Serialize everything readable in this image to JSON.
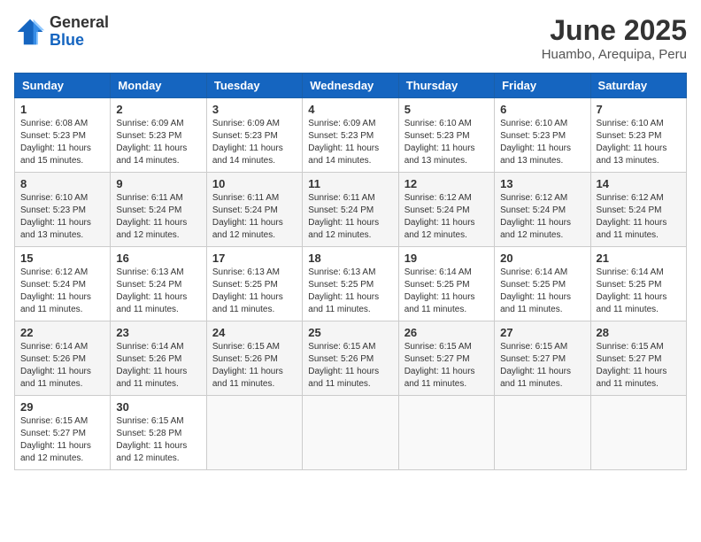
{
  "header": {
    "logo_general": "General",
    "logo_blue": "Blue",
    "month_title": "June 2025",
    "location": "Huambo, Arequipa, Peru"
  },
  "weekdays": [
    "Sunday",
    "Monday",
    "Tuesday",
    "Wednesday",
    "Thursday",
    "Friday",
    "Saturday"
  ],
  "weeks": [
    [
      {
        "day": 1,
        "sunrise": "6:08 AM",
        "sunset": "5:23 PM",
        "daylight": "11 hours and 15 minutes."
      },
      {
        "day": 2,
        "sunrise": "6:09 AM",
        "sunset": "5:23 PM",
        "daylight": "11 hours and 14 minutes."
      },
      {
        "day": 3,
        "sunrise": "6:09 AM",
        "sunset": "5:23 PM",
        "daylight": "11 hours and 14 minutes."
      },
      {
        "day": 4,
        "sunrise": "6:09 AM",
        "sunset": "5:23 PM",
        "daylight": "11 hours and 14 minutes."
      },
      {
        "day": 5,
        "sunrise": "6:10 AM",
        "sunset": "5:23 PM",
        "daylight": "11 hours and 13 minutes."
      },
      {
        "day": 6,
        "sunrise": "6:10 AM",
        "sunset": "5:23 PM",
        "daylight": "11 hours and 13 minutes."
      },
      {
        "day": 7,
        "sunrise": "6:10 AM",
        "sunset": "5:23 PM",
        "daylight": "11 hours and 13 minutes."
      }
    ],
    [
      {
        "day": 8,
        "sunrise": "6:10 AM",
        "sunset": "5:23 PM",
        "daylight": "11 hours and 13 minutes."
      },
      {
        "day": 9,
        "sunrise": "6:11 AM",
        "sunset": "5:24 PM",
        "daylight": "11 hours and 12 minutes."
      },
      {
        "day": 10,
        "sunrise": "6:11 AM",
        "sunset": "5:24 PM",
        "daylight": "11 hours and 12 minutes."
      },
      {
        "day": 11,
        "sunrise": "6:11 AM",
        "sunset": "5:24 PM",
        "daylight": "11 hours and 12 minutes."
      },
      {
        "day": 12,
        "sunrise": "6:12 AM",
        "sunset": "5:24 PM",
        "daylight": "11 hours and 12 minutes."
      },
      {
        "day": 13,
        "sunrise": "6:12 AM",
        "sunset": "5:24 PM",
        "daylight": "11 hours and 12 minutes."
      },
      {
        "day": 14,
        "sunrise": "6:12 AM",
        "sunset": "5:24 PM",
        "daylight": "11 hours and 11 minutes."
      }
    ],
    [
      {
        "day": 15,
        "sunrise": "6:12 AM",
        "sunset": "5:24 PM",
        "daylight": "11 hours and 11 minutes."
      },
      {
        "day": 16,
        "sunrise": "6:13 AM",
        "sunset": "5:24 PM",
        "daylight": "11 hours and 11 minutes."
      },
      {
        "day": 17,
        "sunrise": "6:13 AM",
        "sunset": "5:25 PM",
        "daylight": "11 hours and 11 minutes."
      },
      {
        "day": 18,
        "sunrise": "6:13 AM",
        "sunset": "5:25 PM",
        "daylight": "11 hours and 11 minutes."
      },
      {
        "day": 19,
        "sunrise": "6:14 AM",
        "sunset": "5:25 PM",
        "daylight": "11 hours and 11 minutes."
      },
      {
        "day": 20,
        "sunrise": "6:14 AM",
        "sunset": "5:25 PM",
        "daylight": "11 hours and 11 minutes."
      },
      {
        "day": 21,
        "sunrise": "6:14 AM",
        "sunset": "5:25 PM",
        "daylight": "11 hours and 11 minutes."
      }
    ],
    [
      {
        "day": 22,
        "sunrise": "6:14 AM",
        "sunset": "5:26 PM",
        "daylight": "11 hours and 11 minutes."
      },
      {
        "day": 23,
        "sunrise": "6:14 AM",
        "sunset": "5:26 PM",
        "daylight": "11 hours and 11 minutes."
      },
      {
        "day": 24,
        "sunrise": "6:15 AM",
        "sunset": "5:26 PM",
        "daylight": "11 hours and 11 minutes."
      },
      {
        "day": 25,
        "sunrise": "6:15 AM",
        "sunset": "5:26 PM",
        "daylight": "11 hours and 11 minutes."
      },
      {
        "day": 26,
        "sunrise": "6:15 AM",
        "sunset": "5:27 PM",
        "daylight": "11 hours and 11 minutes."
      },
      {
        "day": 27,
        "sunrise": "6:15 AM",
        "sunset": "5:27 PM",
        "daylight": "11 hours and 11 minutes."
      },
      {
        "day": 28,
        "sunrise": "6:15 AM",
        "sunset": "5:27 PM",
        "daylight": "11 hours and 11 minutes."
      }
    ],
    [
      {
        "day": 29,
        "sunrise": "6:15 AM",
        "sunset": "5:27 PM",
        "daylight": "11 hours and 12 minutes."
      },
      {
        "day": 30,
        "sunrise": "6:15 AM",
        "sunset": "5:28 PM",
        "daylight": "11 hours and 12 minutes."
      },
      null,
      null,
      null,
      null,
      null
    ]
  ]
}
